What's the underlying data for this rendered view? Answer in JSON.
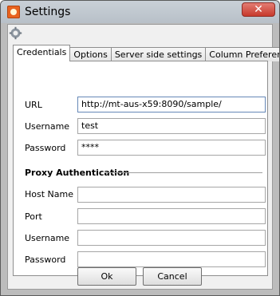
{
  "window": {
    "title": "Settings",
    "close_symbol": "✕",
    "app_icon": "settings-app-icon",
    "toolbar_icon": "gear-icon"
  },
  "tabs": [
    {
      "label": "Credentials",
      "active": true
    },
    {
      "label": "Options",
      "active": false
    },
    {
      "label": "Server side settings",
      "active": false
    },
    {
      "label": "Column Preferences",
      "active": false
    }
  ],
  "credentials": {
    "url_label": "URL",
    "url_value": "http://mt-aus-x59:8090/sample/",
    "username_label": "Username",
    "username_value": "test",
    "password_label": "Password",
    "password_value": "****"
  },
  "proxy": {
    "section_title": "Proxy Authentication",
    "host_label": "Host Name",
    "host_value": "",
    "port_label": "Port",
    "port_value": "",
    "username_label": "Username",
    "username_value": "",
    "password_label": "Password",
    "password_value": ""
  },
  "buttons": {
    "ok": "Ok",
    "cancel": "Cancel"
  }
}
